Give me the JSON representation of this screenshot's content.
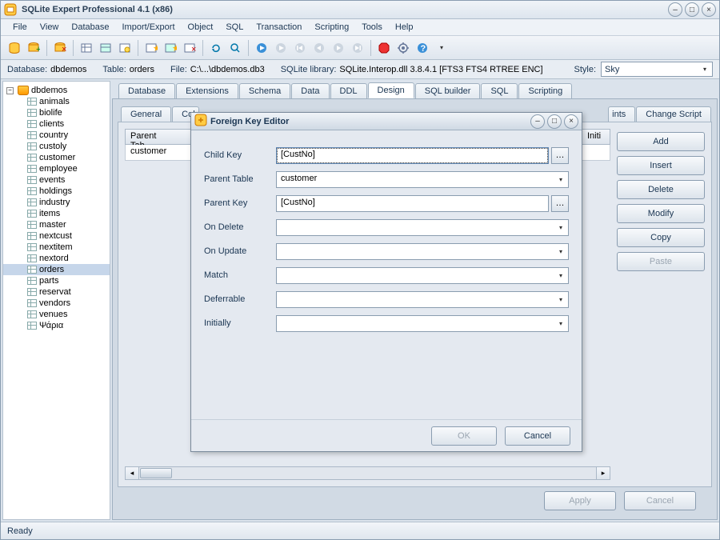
{
  "window": {
    "title": "SQLite Expert Professional 4.1 (x86)"
  },
  "menu": [
    "File",
    "View",
    "Database",
    "Import/Export",
    "Object",
    "SQL",
    "Transaction",
    "Scripting",
    "Tools",
    "Help"
  ],
  "info": {
    "db_label": "Database:",
    "db_value": "dbdemos",
    "table_label": "Table:",
    "table_value": "orders",
    "file_label": "File:",
    "file_value": "C:\\...\\dbdemos.db3",
    "lib_label": "SQLite library:",
    "lib_value": "SQLite.Interop.dll 3.8.4.1 [FTS3 FTS4 RTREE ENC]",
    "style_label": "Style:",
    "style_value": "Sky"
  },
  "tree": {
    "root": "dbdemos",
    "items": [
      "animals",
      "biolife",
      "clients",
      "country",
      "custoly",
      "customer",
      "employee",
      "events",
      "holdings",
      "industry",
      "items",
      "master",
      "nextcust",
      "nextitem",
      "nextord",
      "orders",
      "parts",
      "reservat",
      "vendors",
      "venues",
      "Ψάρια"
    ],
    "selected": "orders"
  },
  "tabs_outer": [
    "Database",
    "Extensions",
    "Schema",
    "Data",
    "DDL",
    "Design",
    "SQL builder",
    "SQL",
    "Scripting"
  ],
  "tabs_inner_left": [
    "General",
    "Col"
  ],
  "tabs_inner_right": [
    "ints",
    "Change Script"
  ],
  "grid": {
    "headers": [
      "Parent Tab",
      "Initi"
    ],
    "row": [
      "customer",
      ""
    ]
  },
  "side_buttons": [
    "Add",
    "Insert",
    "Delete",
    "Modify",
    "Copy",
    "Paste"
  ],
  "footer": {
    "apply": "Apply",
    "cancel": "Cancel"
  },
  "status": "Ready",
  "dialog": {
    "title": "Foreign Key Editor",
    "fields": {
      "child_key_label": "Child Key",
      "child_key_value": "[CustNo]",
      "parent_table_label": "Parent Table",
      "parent_table_value": "customer",
      "parent_key_label": "Parent Key",
      "parent_key_value": "[CustNo]",
      "on_delete_label": "On Delete",
      "on_delete_value": "",
      "on_update_label": "On Update",
      "on_update_value": "",
      "match_label": "Match",
      "match_value": "",
      "deferrable_label": "Deferrable",
      "deferrable_value": "",
      "initially_label": "Initially",
      "initially_value": ""
    },
    "ok": "OK",
    "cancel": "Cancel"
  }
}
